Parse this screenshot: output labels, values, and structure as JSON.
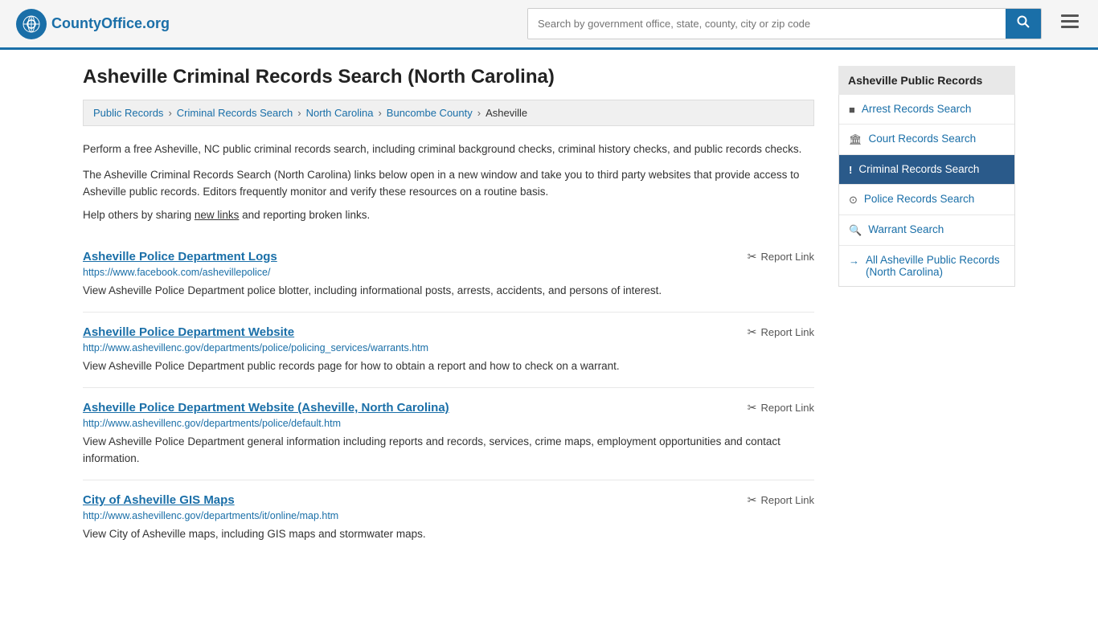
{
  "header": {
    "logo_text": "CountyOffice",
    "logo_org": ".org",
    "search_placeholder": "Search by government office, state, county, city or zip code",
    "search_value": ""
  },
  "page": {
    "title": "Asheville Criminal Records Search (North Carolina)",
    "breadcrumb": [
      {
        "label": "Public Records",
        "href": "#"
      },
      {
        "label": "Criminal Records Search",
        "href": "#"
      },
      {
        "label": "North Carolina",
        "href": "#"
      },
      {
        "label": "Buncombe County",
        "href": "#"
      },
      {
        "label": "Asheville",
        "href": "#"
      }
    ],
    "desc1": "Perform a free Asheville, NC public criminal records search, including criminal background checks, criminal history checks, and public records checks.",
    "desc2": "The Asheville Criminal Records Search (North Carolina) links below open in a new window and take you to third party websites that provide access to Asheville public records. Editors frequently monitor and verify these resources on a routine basis.",
    "help_text": "Help others by sharing ",
    "help_link": "new links",
    "help_text2": " and reporting broken links."
  },
  "results": [
    {
      "title": "Asheville Police Department Logs",
      "url": "https://www.facebook.com/ashevillepolice/",
      "desc": "View Asheville Police Department police blotter, including informational posts, arrests, accidents, and persons of interest.",
      "report_label": "Report Link"
    },
    {
      "title": "Asheville Police Department Website",
      "url": "http://www.ashevillenc.gov/departments/police/policing_services/warrants.htm",
      "desc": "View Asheville Police Department public records page for how to obtain a report and how to check on a warrant.",
      "report_label": "Report Link"
    },
    {
      "title": "Asheville Police Department Website (Asheville, North Carolina)",
      "url": "http://www.ashevillenc.gov/departments/police/default.htm",
      "desc": "View Asheville Police Department general information including reports and records, services, crime maps, employment opportunities and contact information.",
      "report_label": "Report Link"
    },
    {
      "title": "City of Asheville GIS Maps",
      "url": "http://www.ashevillenc.gov/departments/it/online/map.htm",
      "desc": "View City of Asheville maps, including GIS maps and stormwater maps.",
      "report_label": "Report Link"
    }
  ],
  "sidebar": {
    "title": "Asheville Public Records",
    "items": [
      {
        "label": "Arrest Records Search",
        "icon": "■",
        "active": false
      },
      {
        "label": "Court Records Search",
        "icon": "🏛",
        "active": false
      },
      {
        "label": "Criminal Records Search",
        "icon": "!",
        "active": true
      },
      {
        "label": "Police Records Search",
        "icon": "⊙",
        "active": false
      },
      {
        "label": "Warrant Search",
        "icon": "🔍",
        "active": false
      },
      {
        "label": "All Asheville Public Records (North Carolina)",
        "icon": "→",
        "active": false,
        "all": true
      }
    ]
  }
}
